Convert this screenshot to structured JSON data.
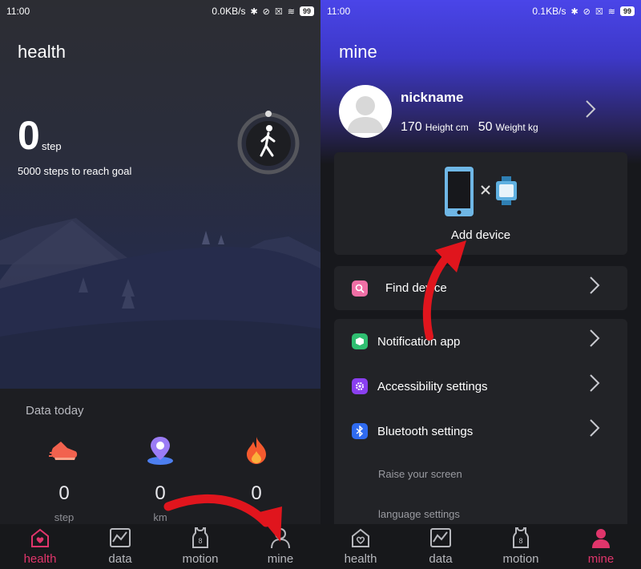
{
  "left": {
    "status": {
      "time": "11:00",
      "speed": "0.0KB/s",
      "battery": "99"
    },
    "title": "health",
    "steps": {
      "value": "0",
      "unit": "step",
      "goal_text": "5000 steps to reach goal"
    },
    "data_today": {
      "label": "Data today",
      "items": [
        {
          "icon": "shoe-icon",
          "value": "0",
          "unit": "step"
        },
        {
          "icon": "location-pin-icon",
          "value": "0",
          "unit": "km"
        },
        {
          "icon": "flame-icon",
          "value": "0",
          "unit": ""
        }
      ]
    },
    "tabs": [
      {
        "label": "health",
        "icon": "heart-house-icon",
        "active": true
      },
      {
        "label": "data",
        "icon": "chart-icon",
        "active": false
      },
      {
        "label": "motion",
        "icon": "jersey-icon",
        "active": false
      },
      {
        "label": "mine",
        "icon": "person-icon",
        "active": false
      }
    ]
  },
  "right": {
    "status": {
      "time": "11:00",
      "speed": "0.1KB/s",
      "battery": "99"
    },
    "title": "mine",
    "profile": {
      "nickname": "nickname",
      "height_value": "170",
      "height_unit": "Height cm",
      "weight_value": "50",
      "weight_unit": "Weight kg"
    },
    "add_device": {
      "label": "Add device"
    },
    "find_device": {
      "label": "Find device",
      "icon_color": "#f06fa6"
    },
    "menu": [
      {
        "label": "Notification app",
        "icon_color": "#2fbf71"
      },
      {
        "label": "Accessibility settings",
        "icon_color": "#8a3ff0"
      },
      {
        "label": "Bluetooth settings",
        "icon_color": "#2f6bf0"
      }
    ],
    "sub_items": [
      "Raise your screen",
      "language settings"
    ],
    "tabs": [
      {
        "label": "health",
        "icon": "heart-house-icon",
        "active": false
      },
      {
        "label": "data",
        "icon": "chart-icon",
        "active": false
      },
      {
        "label": "motion",
        "icon": "jersey-icon",
        "active": false
      },
      {
        "label": "mine",
        "icon": "person-icon",
        "active": true
      }
    ]
  },
  "colors": {
    "accent": "#e0356b",
    "arrow": "#e0151d"
  }
}
